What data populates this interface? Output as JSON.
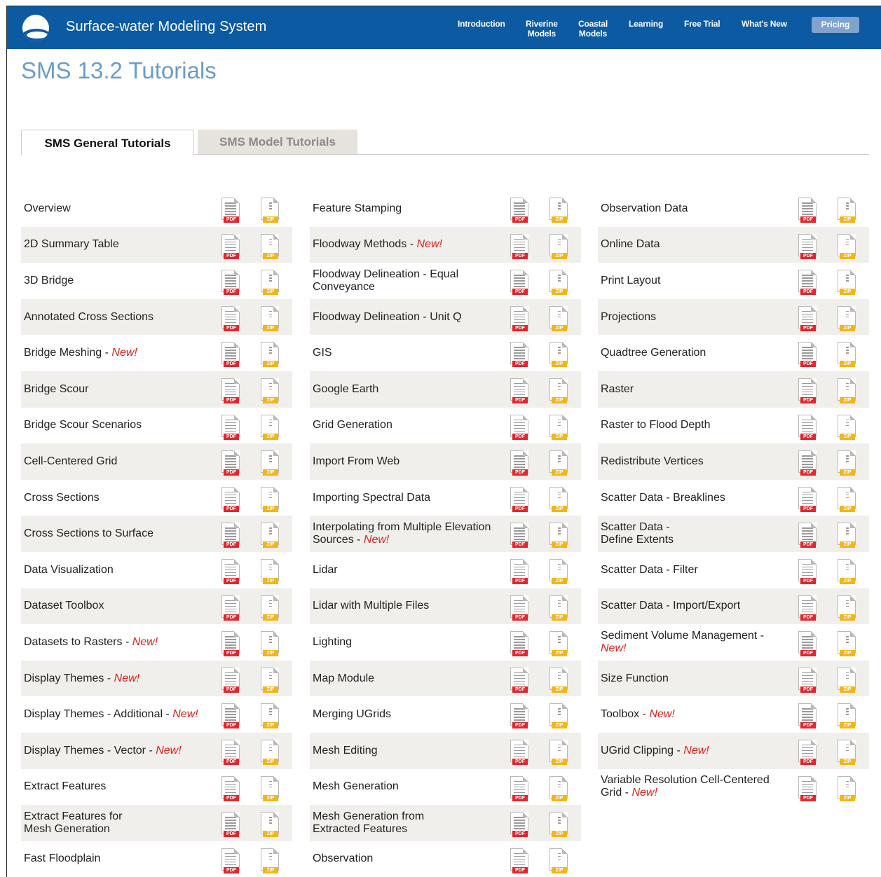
{
  "header": {
    "brand": "Surface-water Modeling System",
    "nav": [
      {
        "label": "Introduction"
      },
      {
        "label": "Riverine\nModels"
      },
      {
        "label": "Coastal\nModels"
      },
      {
        "label": "Learning"
      },
      {
        "label": "Free Trial"
      },
      {
        "label": "What's New"
      }
    ],
    "pricing": "Pricing"
  },
  "page_title": "SMS 13.2 Tutorials",
  "tabs": [
    {
      "label": "SMS General Tutorials",
      "active": true
    },
    {
      "label": "SMS Model Tutorials",
      "active": false
    }
  ],
  "icon_labels": {
    "pdf": "PDF",
    "zip": "ZIP"
  },
  "new_tag": "New!",
  "columns": [
    [
      {
        "title": "Overview"
      },
      {
        "title": "2D Summary Table"
      },
      {
        "title": "3D Bridge"
      },
      {
        "title": "Annotated Cross Sections"
      },
      {
        "title": "Bridge Meshing",
        "new": true
      },
      {
        "title": "Bridge Scour"
      },
      {
        "title": "Bridge Scour Scenarios"
      },
      {
        "title": "Cell-Centered Grid"
      },
      {
        "title": "Cross Sections"
      },
      {
        "title": "Cross Sections to Surface"
      },
      {
        "title": "Data Visualization"
      },
      {
        "title": "Dataset Toolbox"
      },
      {
        "title": "Datasets to Rasters",
        "new": true
      },
      {
        "title": "Display Themes",
        "new": true
      },
      {
        "title": "Display Themes - Additional",
        "new": true
      },
      {
        "title": "Display Themes - Vector",
        "new": true
      },
      {
        "title": "Extract Features"
      },
      {
        "title": "Extract Features for\nMesh Generation"
      },
      {
        "title": "Fast Floodplain"
      }
    ],
    [
      {
        "title": "Feature Stamping"
      },
      {
        "title": "Floodway Methods",
        "new": true
      },
      {
        "title": "Floodway Delineation - Equal\nConveyance"
      },
      {
        "title": "Floodway Delineation - Unit Q"
      },
      {
        "title": "GIS"
      },
      {
        "title": "Google Earth"
      },
      {
        "title": "Grid Generation"
      },
      {
        "title": "Import From Web"
      },
      {
        "title": "Importing Spectral Data"
      },
      {
        "title": "Interpolating from Multiple Elevation\nSources",
        "new": true
      },
      {
        "title": "Lidar"
      },
      {
        "title": "Lidar with Multiple Files"
      },
      {
        "title": "Lighting"
      },
      {
        "title": "Map Module"
      },
      {
        "title": "Merging UGrids"
      },
      {
        "title": "Mesh Editing"
      },
      {
        "title": "Mesh Generation"
      },
      {
        "title": "Mesh Generation from\nExtracted Features"
      },
      {
        "title": "Observation"
      }
    ],
    [
      {
        "title": "Observation Data"
      },
      {
        "title": "Online Data"
      },
      {
        "title": "Print Layout"
      },
      {
        "title": "Projections"
      },
      {
        "title": "Quadtree Generation"
      },
      {
        "title": "Raster"
      },
      {
        "title": "Raster to Flood Depth"
      },
      {
        "title": "Redistribute Vertices"
      },
      {
        "title": "Scatter Data - Breaklines"
      },
      {
        "title": "Scatter Data -\nDefine Extents"
      },
      {
        "title": "Scatter Data - Filter"
      },
      {
        "title": "Scatter Data - Import/Export"
      },
      {
        "title": "Sediment Volume Management -",
        "new": true,
        "new_newline": true
      },
      {
        "title": "Size Function"
      },
      {
        "title": "Toolbox",
        "new": true
      },
      {
        "title": "UGrid Clipping",
        "new": true
      },
      {
        "title": "Variable Resolution Cell-Centered\nGrid",
        "new": true
      }
    ]
  ]
}
